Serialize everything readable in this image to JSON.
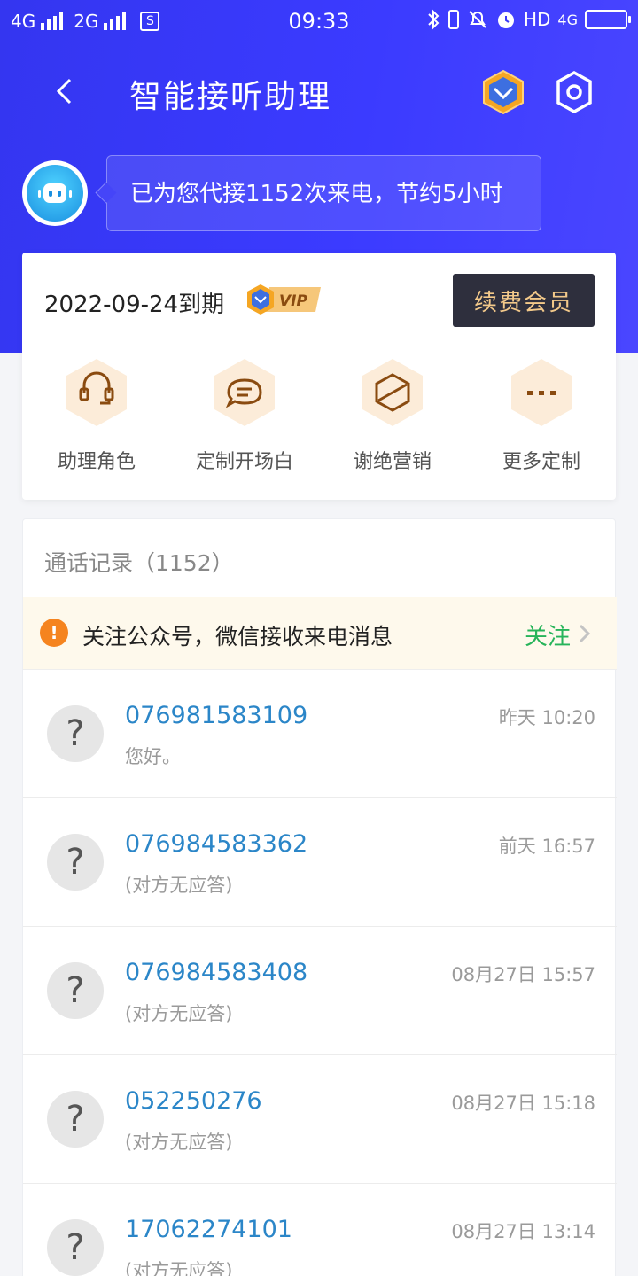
{
  "status_bar": {
    "net1": "4G",
    "net2": "2G",
    "sim_icon": "s-icon",
    "time": "09:33",
    "hd": "HD",
    "net3": "4G"
  },
  "header": {
    "title": "智能接听助理"
  },
  "assistant": {
    "message": "已为您代接1152次来电，节约5小时"
  },
  "membership": {
    "expire_text": "2022-09-24到期",
    "vip_label": "VIP",
    "renew_label": "续费会员"
  },
  "features": [
    {
      "label": "助理角色",
      "icon": "headset-icon"
    },
    {
      "label": "定制开场白",
      "icon": "chat-bubble-icon"
    },
    {
      "label": "谢绝营销",
      "icon": "block-icon"
    },
    {
      "label": "更多定制",
      "icon": "more-dots-icon"
    }
  ],
  "call_log": {
    "title": "通话记录（1152）",
    "notice": {
      "text": "关注公众号，微信接收来电消息",
      "action": "关注"
    },
    "rows": [
      {
        "number": "076981583109",
        "summary": "您好。",
        "time": "昨天 10:20"
      },
      {
        "number": "076984583362",
        "summary": "(对方无应答)",
        "time": "前天 16:57"
      },
      {
        "number": "076984583408",
        "summary": "(对方无应答)",
        "time": "08月27日 15:57"
      },
      {
        "number": "052250276",
        "summary": "(对方无应答)",
        "time": "08月27日 15:18"
      },
      {
        "number": "17062274101",
        "summary": "(对方无应答)",
        "time": "08月27日 13:14"
      }
    ]
  },
  "colors": {
    "header_blue": "#3a3af8",
    "number_blue": "#2b86c8",
    "follow_green": "#27b45a",
    "gold": "#f3c98a",
    "dark_button": "#2e2f3d"
  }
}
